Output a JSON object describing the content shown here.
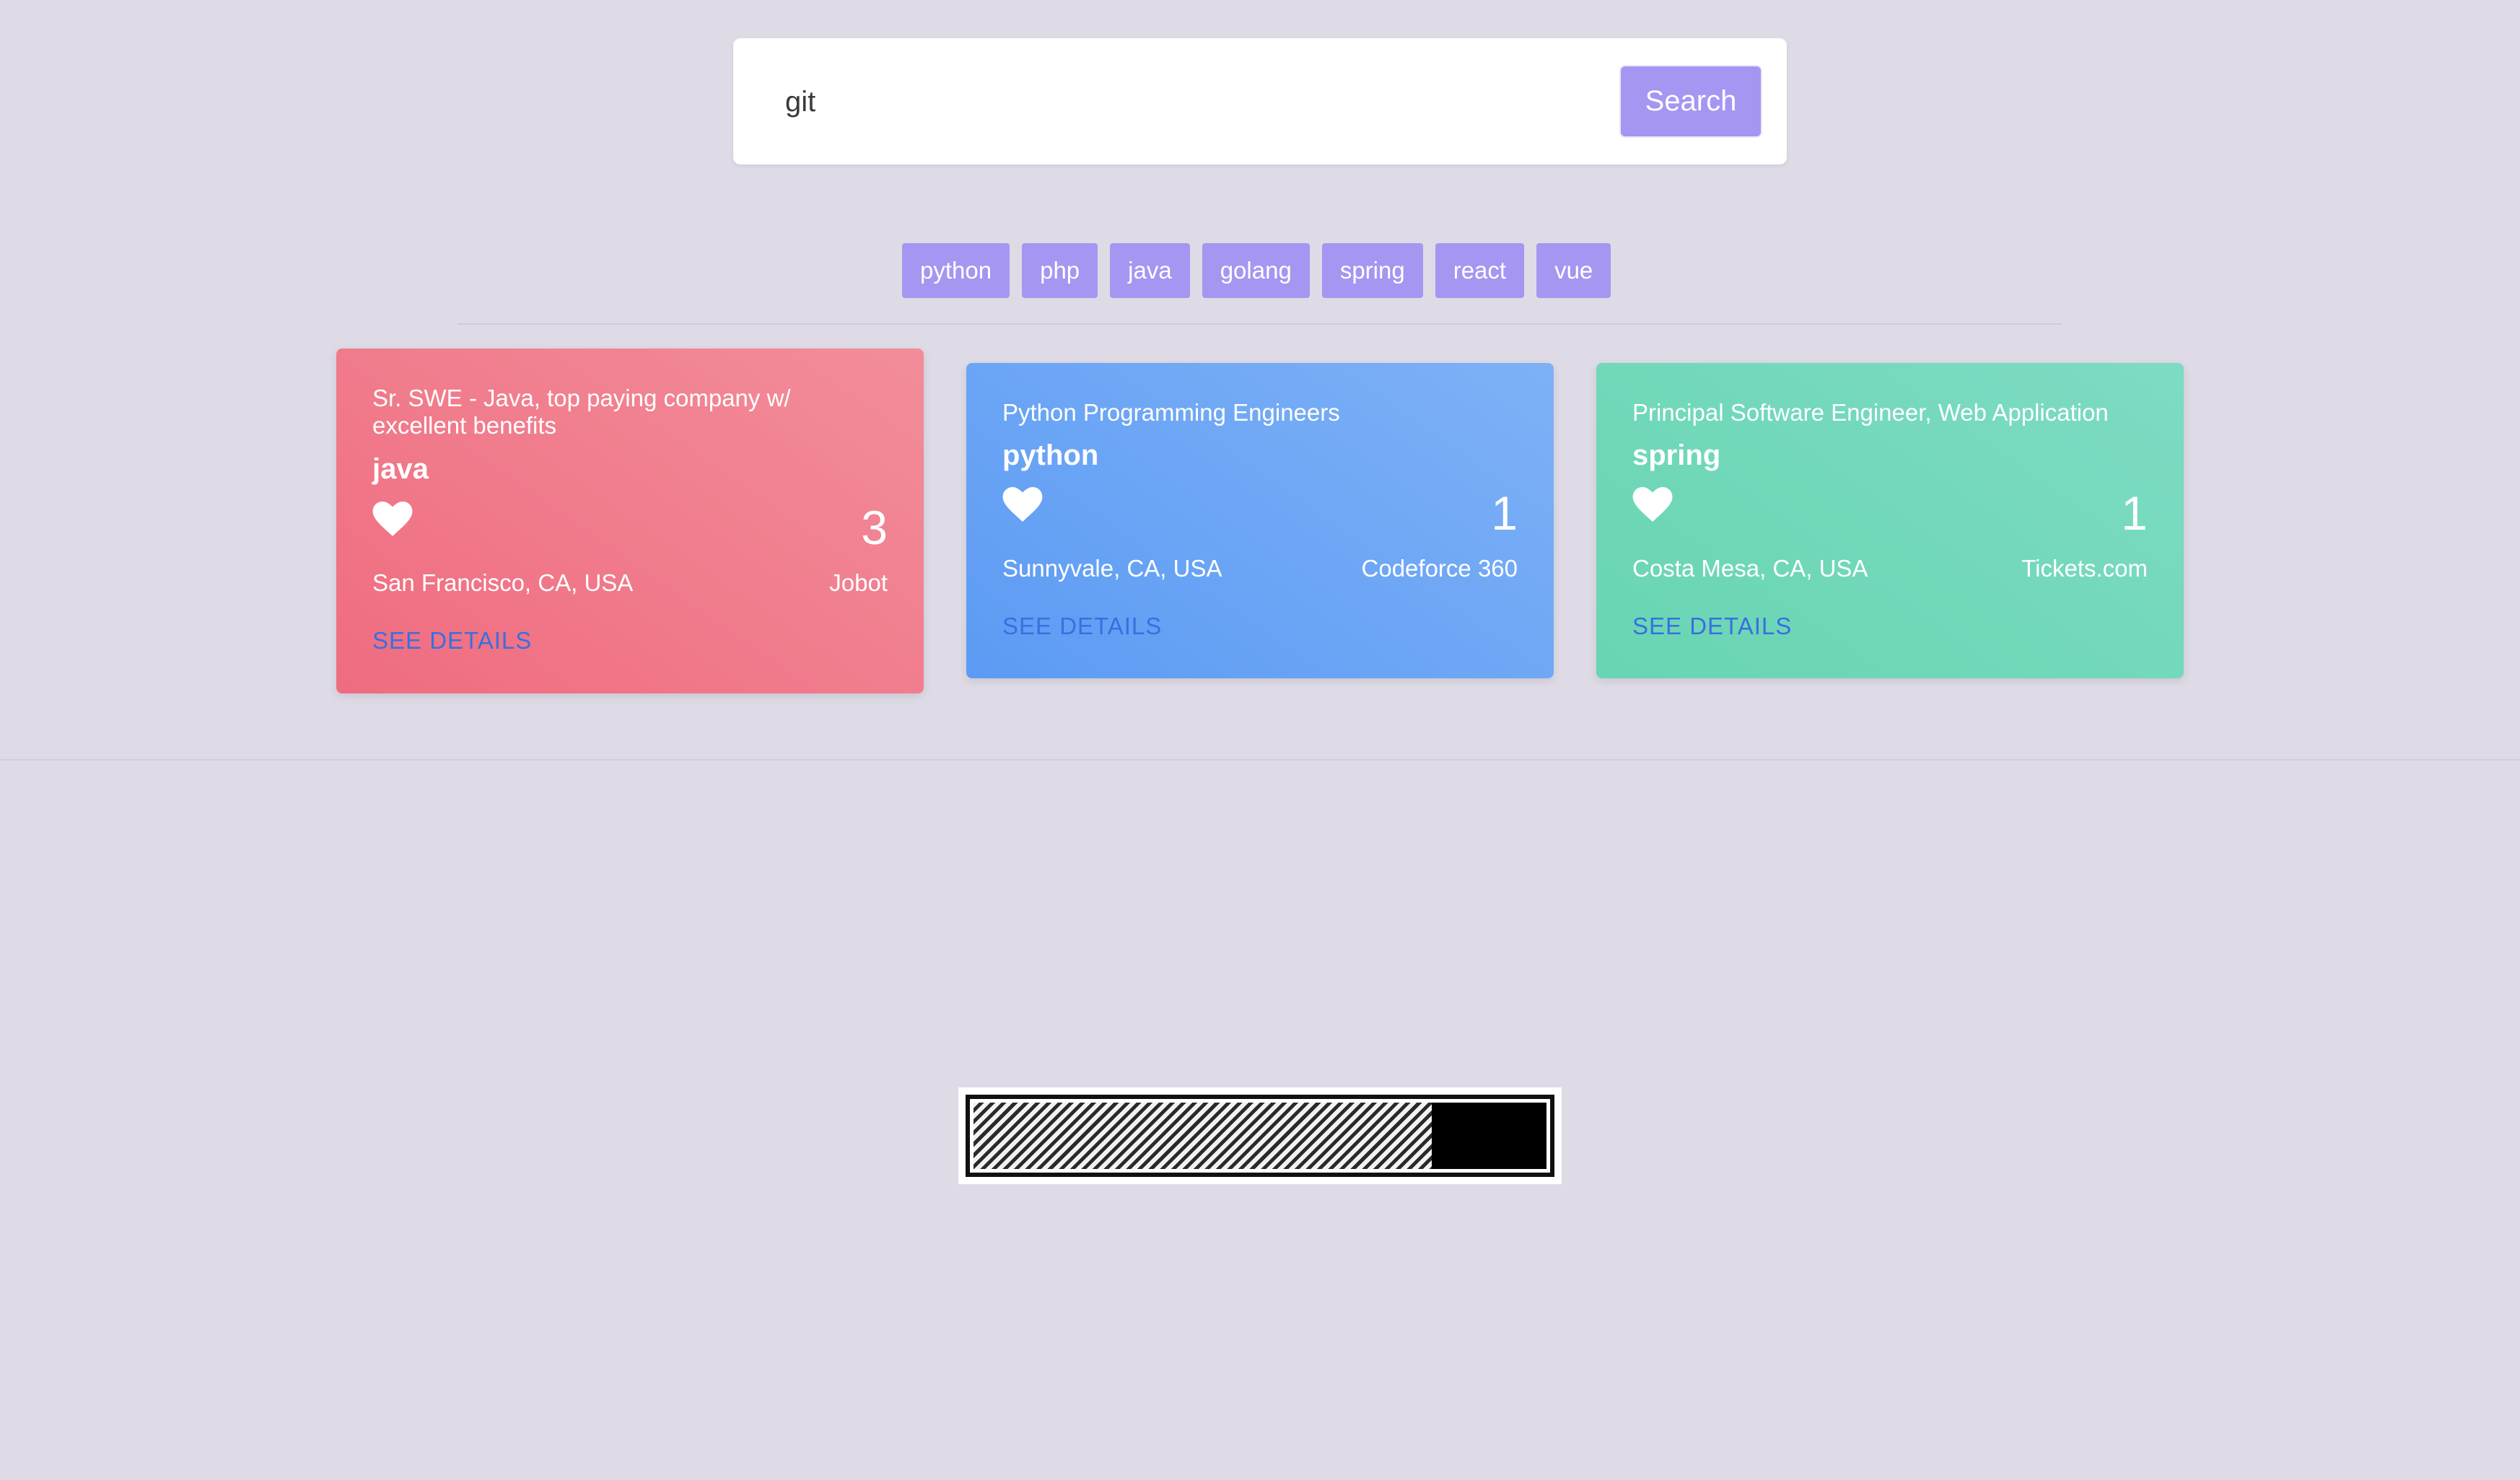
{
  "search": {
    "value": "git",
    "button_label": "Search"
  },
  "tags": [
    "python",
    "php",
    "java",
    "golang",
    "spring",
    "react",
    "vue"
  ],
  "cards": [
    {
      "title": "Sr. SWE - Java, top paying company w/ excellent benefits",
      "tag": "java",
      "count": "3",
      "location": "San Francisco, CA, USA",
      "company": "Jobot",
      "link_label": "SEE DETAILS",
      "color": "#ef6c7f"
    },
    {
      "title": "Python Programming Engineers",
      "tag": "python",
      "count": "1",
      "location": "Sunnyvale, CA, USA",
      "company": "Codeforce 360",
      "link_label": "SEE DETAILS",
      "color": "#5c9bf4"
    },
    {
      "title": "Principal Software Engineer, Web Application",
      "tag": "spring",
      "count": "1",
      "location": "Costa Mesa, CA, USA",
      "company": "Tickets.com",
      "link_label": "SEE DETAILS",
      "color": "#68d5b3"
    }
  ],
  "loader": {
    "progress": 0.2
  },
  "colors": {
    "background": "#dedbe6",
    "accent": "#a596f2",
    "link": "#3a6fe0"
  }
}
